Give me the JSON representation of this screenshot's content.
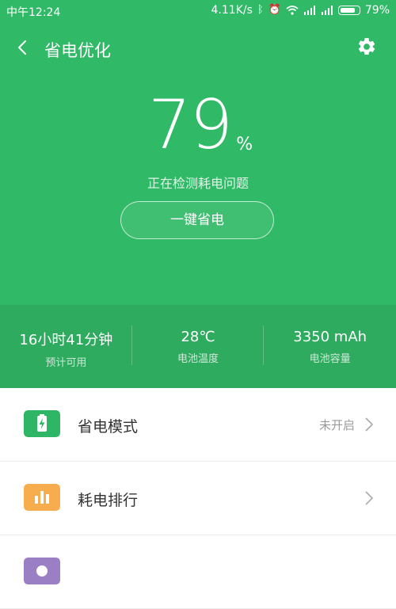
{
  "status_bar": {
    "time": "中午12:24",
    "network_speed": "4.11K/s",
    "battery": "79%",
    "icons": [
      "bluetooth-icon",
      "alarm-icon",
      "wifi-icon",
      "signal-icon",
      "signal-icon",
      "battery-icon"
    ]
  },
  "topbar": {
    "title": "省电优化",
    "back_icon": "back-icon",
    "settings_icon": "gear-icon"
  },
  "battery_level": {
    "value": "79",
    "unit": "%",
    "status": "正在检测耗电问题"
  },
  "actions": {
    "one_key_save": "一键省电"
  },
  "stats": [
    {
      "value": "16小时41分钟",
      "label": "预计可用"
    },
    {
      "value": "28℃",
      "label": "电池温度"
    },
    {
      "value": "3350 mAh",
      "label": "电池容量"
    }
  ],
  "menu": [
    {
      "label": "省电模式",
      "status": "未开启",
      "icon": "battery-charge-icon",
      "color": "#2fb566"
    },
    {
      "label": "耗电排行",
      "status": "",
      "icon": "bar-chart-icon",
      "color": "#f7ad4d"
    }
  ],
  "colors": {
    "primary": "#30b967",
    "stats_bg": "#2eab5f"
  }
}
